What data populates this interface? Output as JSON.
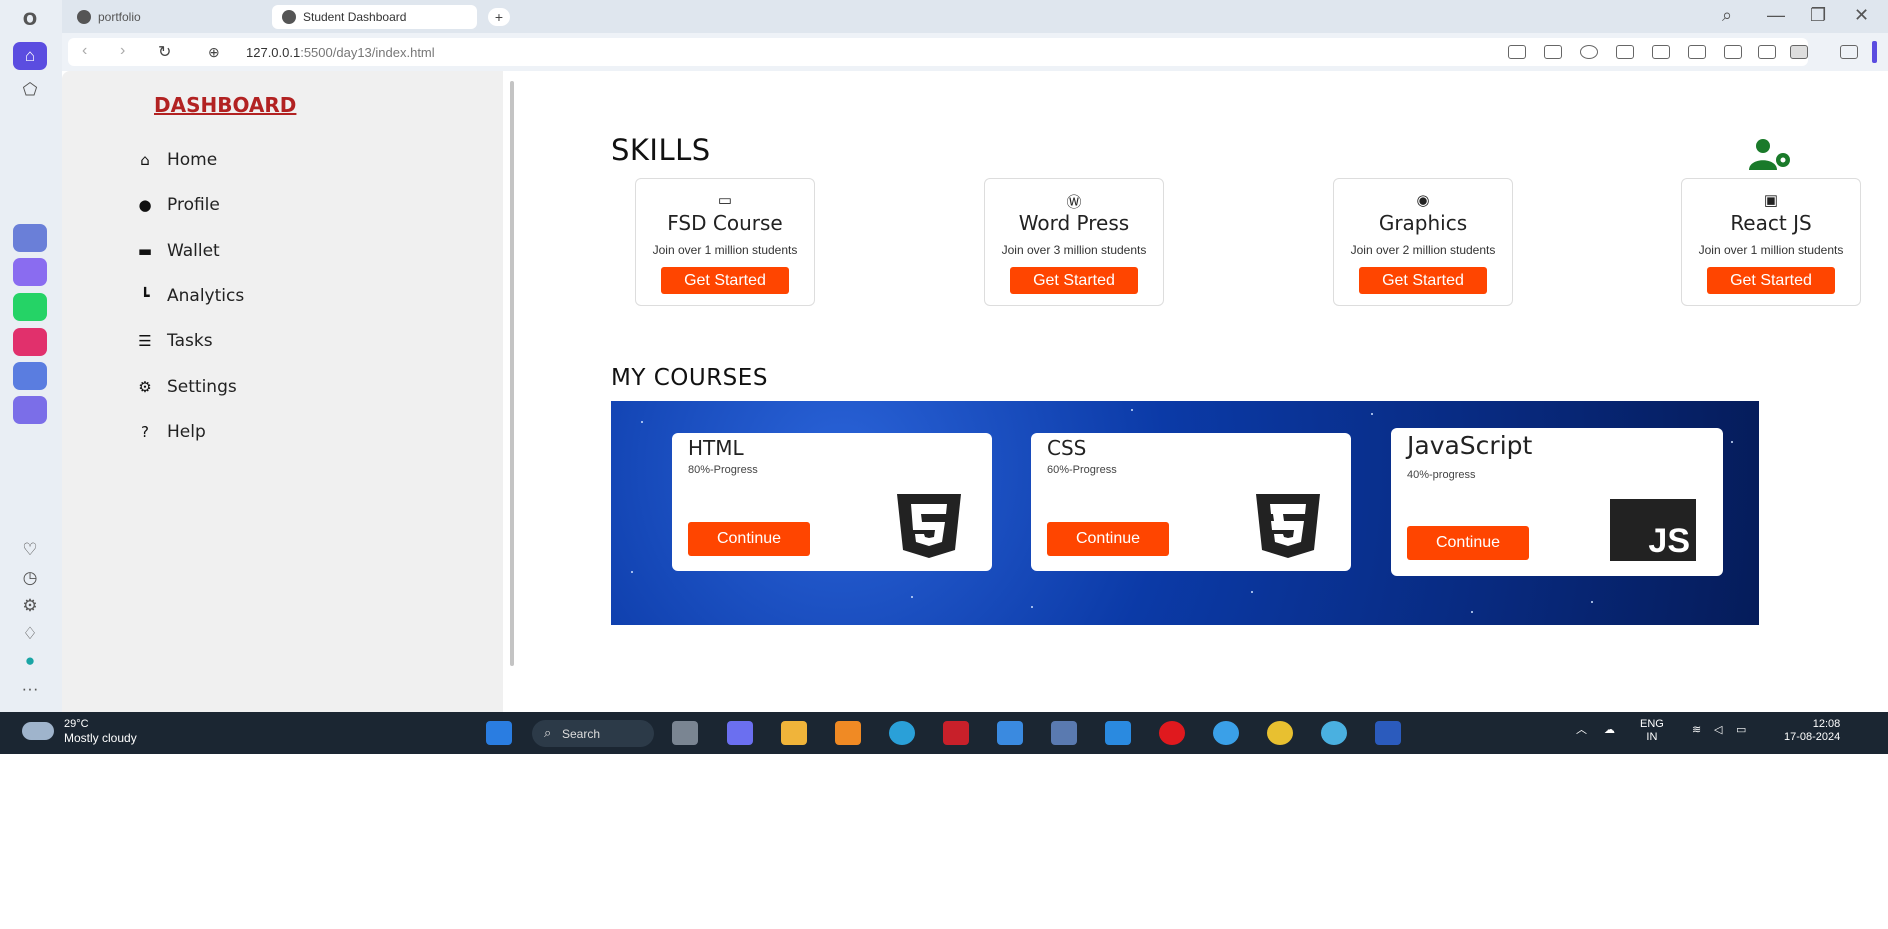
{
  "browser": {
    "tabs": [
      {
        "label": "portfolio",
        "active": false
      },
      {
        "label": "Student Dashboard",
        "active": true
      }
    ],
    "url_host": "127.0.0.1",
    "url_path": ":5500/day13/index.html"
  },
  "sidebar": {
    "brand": "DASHBOARD",
    "items": [
      {
        "label": "Home",
        "icon": "home-icon"
      },
      {
        "label": "Profile",
        "icon": "user-icon"
      },
      {
        "label": "Wallet",
        "icon": "wallet-icon"
      },
      {
        "label": "Analytics",
        "icon": "chart-icon"
      },
      {
        "label": "Tasks",
        "icon": "tasks-icon"
      },
      {
        "label": "Settings",
        "icon": "gear-icon"
      },
      {
        "label": "Help",
        "icon": "help-icon"
      }
    ]
  },
  "skills": {
    "title": "SKILLS",
    "cards": [
      {
        "title": "FSD Course",
        "subtitle": "Join over 1 million students",
        "button": "Get Started",
        "icon": "laptop-icon"
      },
      {
        "title": "Word Press",
        "subtitle": "Join over 3 million students",
        "button": "Get Started",
        "icon": "wordpress-icon"
      },
      {
        "title": "Graphics",
        "subtitle": "Join over 2 million students",
        "button": "Get Started",
        "icon": "palette-icon"
      },
      {
        "title": "React JS",
        "subtitle": "Join over 1 million students",
        "button": "Get Started",
        "icon": "js-icon"
      }
    ]
  },
  "courses": {
    "title": "MY COURSES",
    "cards": [
      {
        "title": "HTML",
        "progress": "80%-Progress",
        "button": "Continue",
        "logo": "html5-logo"
      },
      {
        "title": "CSS",
        "progress": "60%-Progress",
        "button": "Continue",
        "logo": "css3-logo"
      },
      {
        "title": "JavaScript",
        "progress": "40%-progress",
        "button": "Continue",
        "logo": "js-logo",
        "logo_text": "JS"
      }
    ]
  },
  "taskbar": {
    "temperature": "29°C",
    "condition": "Mostly cloudy",
    "search": "Search",
    "lang_top": "ENG",
    "lang_bottom": "IN",
    "time": "12:08",
    "date": "17-08-2024"
  },
  "colors": {
    "accent": "#ff4500",
    "brand": "#b22222",
    "icon_green": "#1a7a2a"
  }
}
